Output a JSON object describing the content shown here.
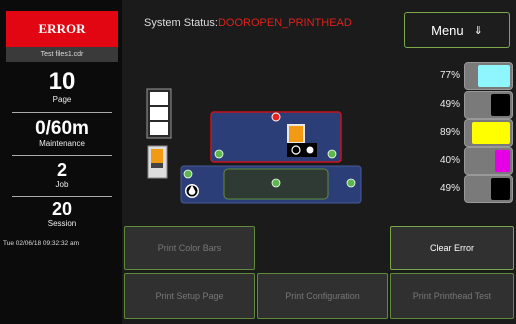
{
  "sidebar": {
    "error_label": "ERROR",
    "file_name": "Test files1.cdr",
    "page": {
      "value": "10",
      "label": "Page"
    },
    "maintenance": {
      "value": "0/60m",
      "label": "Maintenance"
    },
    "job": {
      "value": "2",
      "label": "Job"
    },
    "session": {
      "value": "20",
      "label": "Session"
    },
    "datetime": "Tue 02/06/18 09:32:32 am"
  },
  "header": {
    "status_label": "System Status:",
    "status_value": "DOOROPEN_PRINTHEAD",
    "menu_label": "Menu",
    "menu_arrow": "⇓"
  },
  "inks": [
    {
      "percent": "77%",
      "color": "#8ff6ff",
      "level": 0.77
    },
    {
      "percent": "49%",
      "color": "#000000",
      "level": 0.49
    },
    {
      "percent": "89%",
      "color": "#ffff00",
      "level": 0.89
    },
    {
      "percent": "40%",
      "color": "#e600e6",
      "level": 0.4
    },
    {
      "percent": "49%",
      "color": "#000000",
      "level": 0.49
    }
  ],
  "buttons": {
    "print_color_bars": "Print Color Bars",
    "clear_error": "Clear Error",
    "print_setup_page": "Print Setup Page",
    "print_configuration": "Print Configuration",
    "print_printhead_test": "Print Printhead Test"
  },
  "colors": {
    "error": "#e20613",
    "button_border": "#5e8c3a",
    "panel_blue": "#2b3e78"
  }
}
